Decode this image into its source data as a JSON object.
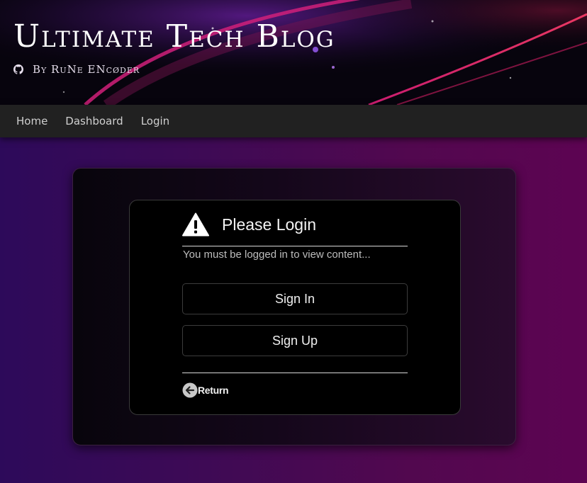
{
  "header": {
    "title": "Ultimate Tech Blog",
    "byline": "By RuNe ENcøder",
    "github_icon": "github-icon"
  },
  "nav": {
    "items": [
      {
        "label": "Home"
      },
      {
        "label": "Dashboard"
      },
      {
        "label": "Login"
      }
    ]
  },
  "login_card": {
    "warning_icon": "warning-triangle-icon",
    "heading": "Please Login",
    "message": "You must be logged in to view content...",
    "sign_in_label": "Sign In",
    "sign_up_label": "Sign Up",
    "return_icon": "arrow-left-circle-icon",
    "return_label": "Return"
  },
  "colors": {
    "background_left": "#2d0a5a",
    "background_right": "#5d0452",
    "navbar": "#212121",
    "card": "#000000",
    "banner_accent": "#c41a7a"
  }
}
